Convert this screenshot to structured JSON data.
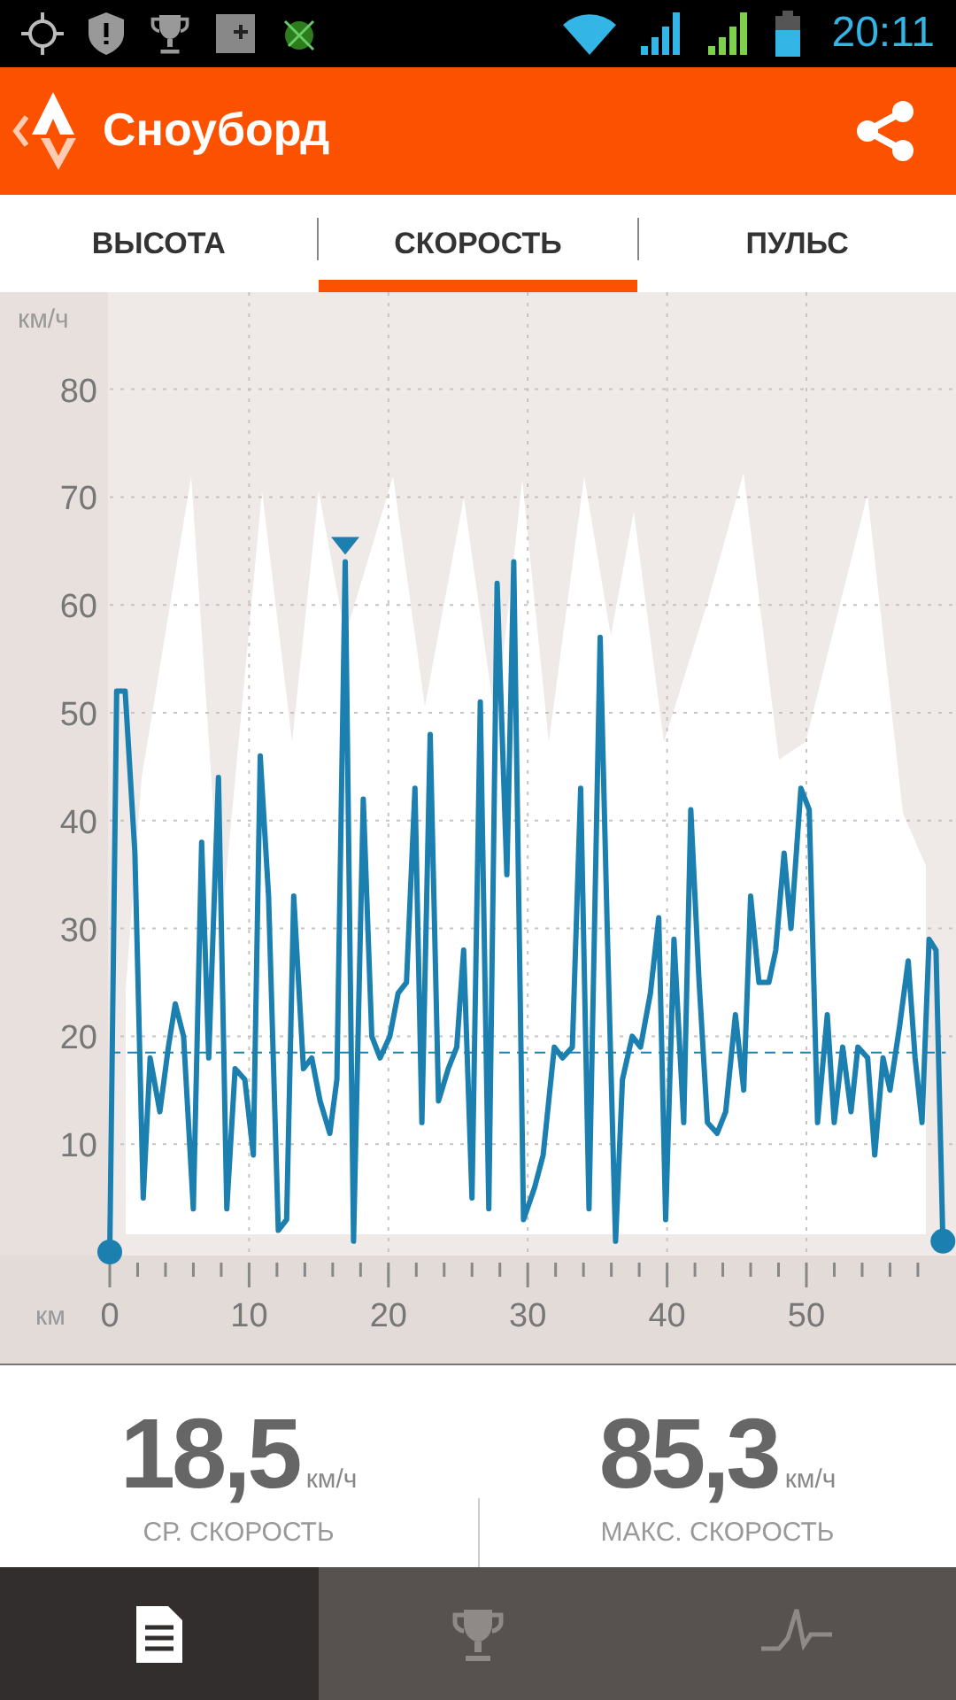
{
  "status_bar": {
    "time": "20:11"
  },
  "app_bar": {
    "title": "Сноуборд"
  },
  "tabs": [
    {
      "label": "ВЫСОТА",
      "selected": false
    },
    {
      "label": "СКОРОСТЬ",
      "selected": true
    },
    {
      "label": "ПУЛЬС",
      "selected": false
    }
  ],
  "chart": {
    "chart_data": {
      "type": "line",
      "xlabel": "км",
      "ylabel": "км/ч",
      "xlim": [
        0,
        60
      ],
      "ylim": [
        0,
        89
      ],
      "xticks": [
        0,
        10,
        20,
        30,
        40,
        50
      ],
      "yticks": [
        10,
        20,
        30,
        40,
        50,
        60,
        70,
        80
      ],
      "x": [
        0,
        0.5,
        1.1,
        1.8,
        2.4,
        2.9,
        3.6,
        4.2,
        4.7,
        5.3,
        6.0,
        6.6,
        7.1,
        7.8,
        8.4,
        9.0,
        9.7,
        10.3,
        10.8,
        11.4,
        12.1,
        12.7,
        13.2,
        13.9,
        14.5,
        15.1,
        15.8,
        16.3,
        16.9,
        17.5,
        18.2,
        18.8,
        19.4,
        20.1,
        20.7,
        21.3,
        21.9,
        22.4,
        23.0,
        23.6,
        24.3,
        24.9,
        25.4,
        26.0,
        26.6,
        27.2,
        27.8,
        28.5,
        29.0,
        29.7,
        30.5,
        31.1,
        31.9,
        32.5,
        33.2,
        33.8,
        34.4,
        35.2,
        35.7,
        36.3,
        36.8,
        37.5,
        38.1,
        38.8,
        39.4,
        39.9,
        40.5,
        41.2,
        41.7,
        42.3,
        42.9,
        43.6,
        44.2,
        44.9,
        45.5,
        46.0,
        46.6,
        47.3,
        47.8,
        48.4,
        48.9,
        49.6,
        50.2,
        50.8,
        51.5,
        52.0,
        52.6,
        53.2,
        53.7,
        54.4,
        54.9,
        55.5,
        56.0,
        56.7,
        57.3,
        57.8,
        58.3,
        58.8,
        59.3,
        59.8
      ],
      "series": [
        {
          "color": "#1b7fb0",
          "values": [
            0,
            52,
            52,
            37,
            5,
            18,
            13,
            19,
            23,
            20,
            4,
            38,
            18,
            44,
            4,
            17,
            16,
            9,
            46,
            33,
            2,
            3,
            33,
            17,
            18,
            14,
            11,
            16,
            64,
            1,
            42,
            20,
            18,
            20,
            24,
            25,
            43,
            12,
            48,
            14,
            17,
            19,
            28,
            5,
            51,
            4,
            62,
            35,
            64,
            3,
            6,
            9,
            19,
            18,
            19,
            43,
            4,
            57,
            30,
            1,
            16,
            20,
            19,
            24,
            31,
            3,
            29,
            12,
            41,
            25,
            12,
            11,
            13,
            22,
            15,
            33,
            25,
            25,
            28,
            37,
            30,
            43,
            41,
            12,
            22,
            12,
            19,
            13,
            19,
            18,
            9,
            18,
            15,
            21,
            27,
            18,
            12,
            29,
            28,
            1
          ]
        }
      ],
      "grid": true,
      "ref_lines": [
        {
          "axis": "y",
          "value": 18.5
        }
      ]
    }
  },
  "stats": [
    {
      "value": "18,5",
      "unit": "км/ч",
      "label": "СР. СКОРОСТЬ"
    },
    {
      "value": "85,3",
      "unit": "км/ч",
      "label": "МАКС. СКОРОСТЬ"
    }
  ],
  "bottom_nav": [
    {
      "kind": "summary",
      "selected": true
    },
    {
      "kind": "achievements",
      "selected": false
    },
    {
      "kind": "analysis",
      "selected": false
    }
  ]
}
